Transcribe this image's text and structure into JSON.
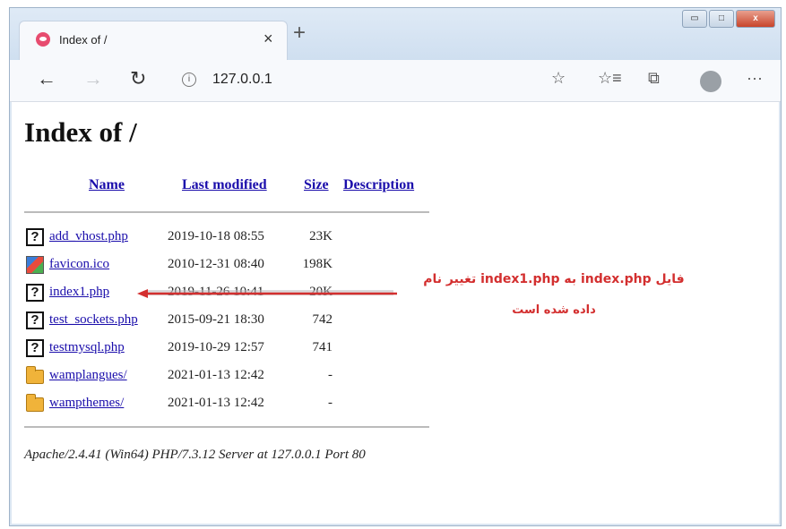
{
  "window": {
    "minimize": "▭",
    "maximize": "□",
    "close": "x"
  },
  "tab": {
    "title": "Index of /",
    "close": "×"
  },
  "new_tab": "+",
  "nav": {
    "back": "←",
    "forward": "→",
    "reload": "↻"
  },
  "address": {
    "info": "i",
    "url": "127.0.0.1"
  },
  "tools": {
    "favorite": "☆",
    "favorites_list": "☆≡",
    "collections": "⧉",
    "more": "···"
  },
  "page": {
    "title": "Index of /",
    "columns": {
      "name": "Name",
      "last_modified": "Last modified",
      "size": "Size",
      "description": "Description"
    },
    "files": [
      {
        "icon": "unknown-file-icon",
        "name": "add_vhost.php",
        "modified": "2019-10-18 08:55",
        "size": "23K"
      },
      {
        "icon": "image-file-icon",
        "name": "favicon.ico",
        "modified": "2010-12-31 08:40",
        "size": "198K"
      },
      {
        "icon": "unknown-file-icon",
        "name": "index1.php",
        "modified": "2019-11-26 10:41",
        "size": "20K"
      },
      {
        "icon": "unknown-file-icon",
        "name": "test_sockets.php",
        "modified": "2015-09-21 18:30",
        "size": "742"
      },
      {
        "icon": "unknown-file-icon",
        "name": "testmysql.php",
        "modified": "2019-10-29 12:57",
        "size": "741"
      },
      {
        "icon": "folder-icon",
        "name": "wamplangues/",
        "modified": "2021-01-13 12:42",
        "size": "-"
      },
      {
        "icon": "folder-icon",
        "name": "wampthemes/",
        "modified": "2021-01-13 12:42",
        "size": "-"
      }
    ],
    "footer": "Apache/2.4.41 (Win64) PHP/7.3.12 Server at 127.0.0.1 Port 80"
  },
  "annotation": {
    "line1": "فایل index.php به index1.php تغییر نام",
    "line2": "داده شده است",
    "color": "#d32f2f"
  }
}
